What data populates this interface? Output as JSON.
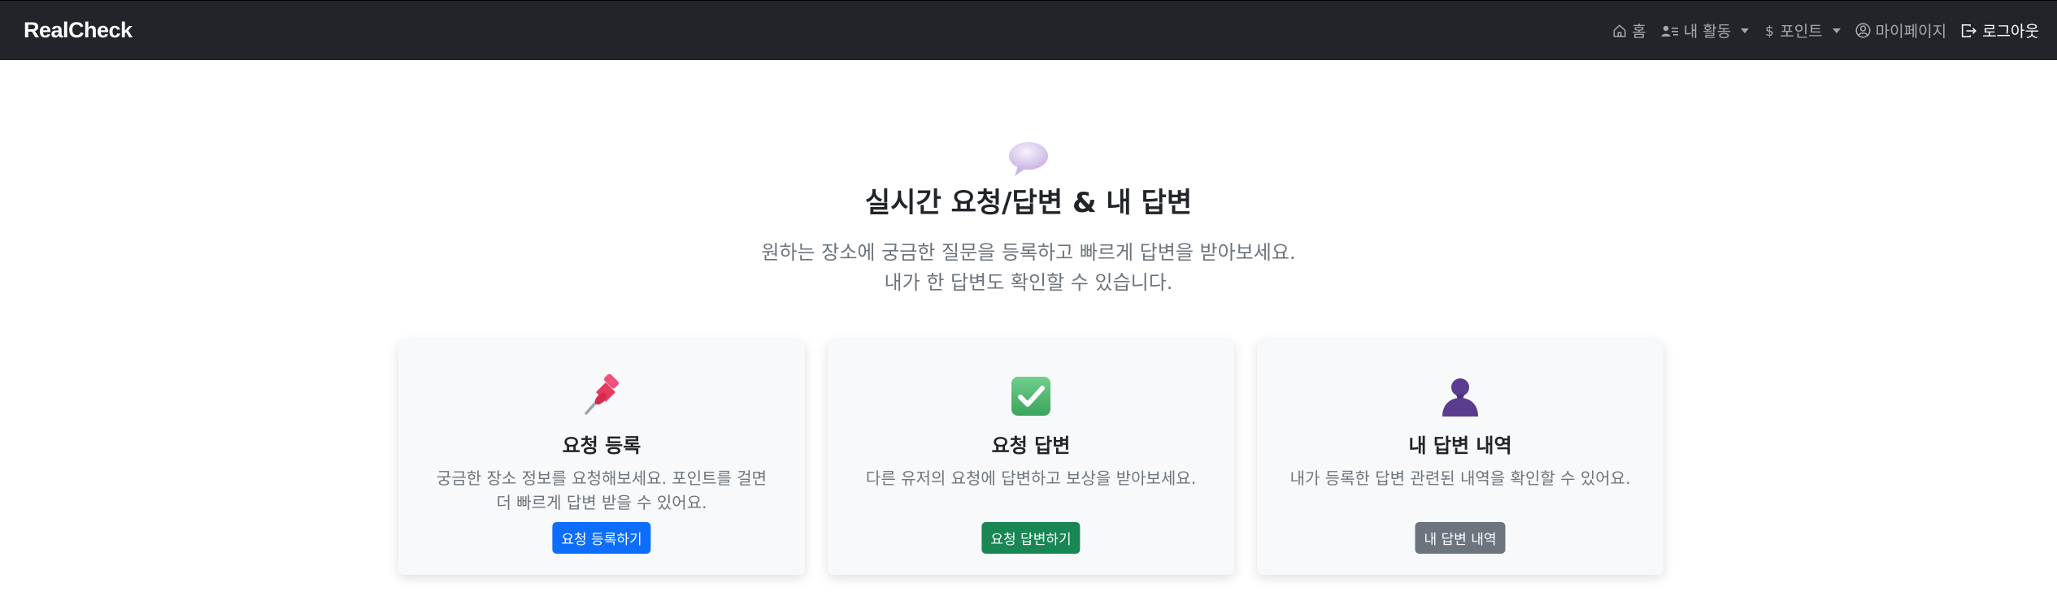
{
  "navbar": {
    "brand": "RealCheck",
    "items": [
      {
        "label": "홈",
        "icon": "house-icon"
      },
      {
        "label": "내 활동",
        "icon": "person-card-icon",
        "dropdown": true
      },
      {
        "label": "포인트",
        "icon": "dollar-icon",
        "dropdown": true
      },
      {
        "label": "마이페이지",
        "icon": "user-circle-icon"
      },
      {
        "label": "로그아웃",
        "icon": "logout-icon"
      }
    ]
  },
  "hero": {
    "icon": "speech-bubble-icon",
    "title": "실시간 요청/답변 & 내 답변",
    "subtitle_line1": "원하는 장소에 궁금한 질문을 등록하고 빠르게 답변을 받아보세요.",
    "subtitle_line2": "내가 한 답변도 확인할 수 있습니다."
  },
  "cards": [
    {
      "icon": "pushpin-icon",
      "title": "요청 등록",
      "desc_line1": "궁금한 장소 정보를 요청해보세요. 포인트를 걸면",
      "desc_line2": "더 빠르게 답변 받을 수 있어요.",
      "button": "요청 등록하기",
      "button_color": "#0d6efd"
    },
    {
      "icon": "checkmark-icon",
      "title": "요청 답변",
      "desc_line1": "다른 유저의 요청에 답변하고 보상을 받아보세요.",
      "desc_line2": "",
      "button": "요청 답변하기",
      "button_color": "#198754"
    },
    {
      "icon": "user-silhouette-icon",
      "title": "내 답변 내역",
      "desc_line1": "내가 등록한 답변 관련된 내역을 확인할 수 있어요.",
      "desc_line2": "",
      "button": "내 답변 내역",
      "button_color": "#6c757d"
    }
  ],
  "colors": {
    "navbar_bg": "#212529",
    "card_bg": "#f8f9fa",
    "primary": "#0d6efd",
    "success": "#198754",
    "secondary": "#6c757d"
  }
}
